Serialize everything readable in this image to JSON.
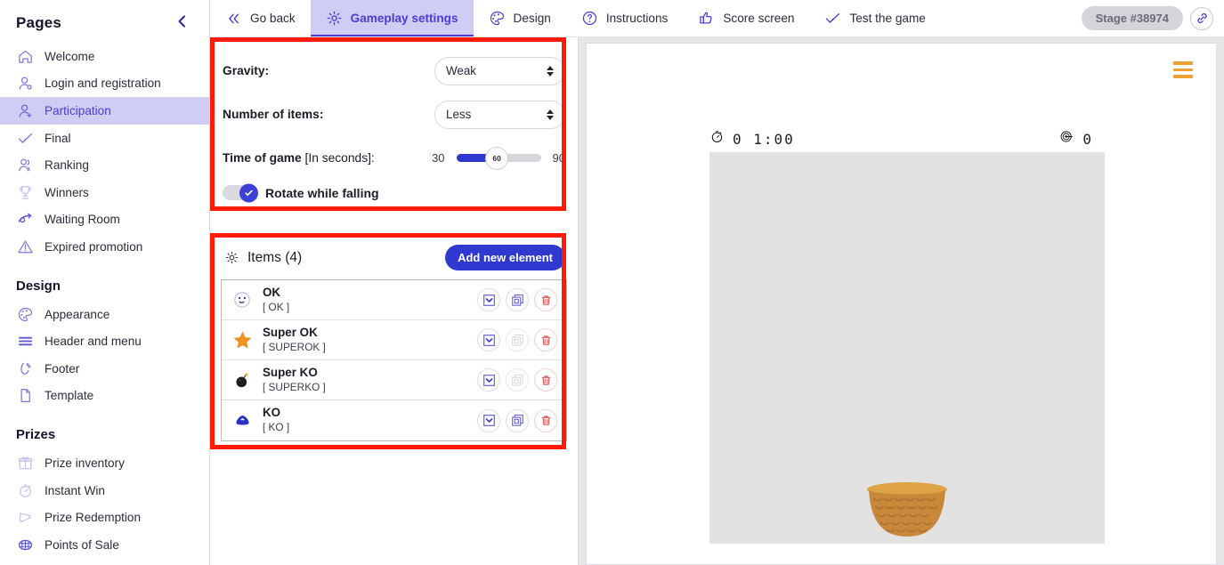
{
  "sidebar": {
    "title": "Pages",
    "collapse_icon": "chevron-left-icon",
    "pages": [
      {
        "label": "Welcome",
        "icon": "home-icon",
        "active": false,
        "dim": false
      },
      {
        "label": "Login and registration",
        "icon": "user-key-icon",
        "active": false,
        "dim": false
      },
      {
        "label": "Participation",
        "icon": "user-plus-icon",
        "active": true,
        "dim": false
      },
      {
        "label": "Final",
        "icon": "check-icon",
        "active": false,
        "dim": false
      },
      {
        "label": "Ranking",
        "icon": "users-icon",
        "active": false,
        "dim": false
      },
      {
        "label": "Winners",
        "icon": "trophy-icon",
        "active": false,
        "dim": true
      },
      {
        "label": "Waiting Room",
        "icon": "clock-arrow-icon",
        "active": false,
        "dim": false
      },
      {
        "label": "Expired promotion",
        "icon": "warning-triangle-icon",
        "active": false,
        "dim": false
      }
    ],
    "groups": [
      {
        "title": "Design",
        "items": [
          {
            "label": "Appearance",
            "icon": "palette-icon",
            "dim": false
          },
          {
            "label": "Header and menu",
            "icon": "menu-lines-icon",
            "dim": false
          },
          {
            "label": "Footer",
            "icon": "footer-shoe-icon",
            "dim": false
          },
          {
            "label": "Template",
            "icon": "document-icon",
            "dim": false
          }
        ]
      },
      {
        "title": "Prizes",
        "items": [
          {
            "label": "Prize inventory",
            "icon": "gift-icon",
            "dim": true
          },
          {
            "label": "Instant Win",
            "icon": "stopwatch-icon",
            "dim": true
          },
          {
            "label": "Prize Redemption",
            "icon": "ticket-icon",
            "dim": true
          },
          {
            "label": "Points of Sale",
            "icon": "globe-grid-icon",
            "dim": false
          }
        ]
      }
    ]
  },
  "topbar": {
    "tabs": [
      {
        "label": "Go back",
        "icon": "double-chevron-left-icon",
        "active": false
      },
      {
        "label": "Gameplay settings",
        "icon": "gear-icon",
        "active": true
      },
      {
        "label": "Design",
        "icon": "palette-icon",
        "active": false
      },
      {
        "label": "Instructions",
        "icon": "question-circle-icon",
        "active": false
      },
      {
        "label": "Score screen",
        "icon": "thumbs-up-icon",
        "active": false
      },
      {
        "label": "Test the game",
        "icon": "check-icon",
        "active": false
      }
    ],
    "stage_badge": "Stage #38974",
    "link_icon": "link-icon"
  },
  "gameplay": {
    "gravity": {
      "label": "Gravity:",
      "value": "Weak"
    },
    "number_of_items": {
      "label": "Number of items:",
      "value": "Less"
    },
    "time_of_game": {
      "label_bold": "Time of game",
      "label_light": "[In seconds]:",
      "min": "30",
      "max": "90",
      "value": "60",
      "fill_percent": 48
    },
    "rotate_while_falling": {
      "label": "Rotate while falling",
      "checked": true
    }
  },
  "items_panel": {
    "gear_icon": "gear-icon",
    "title": "Items (4)",
    "add_button": "Add new element",
    "rows": [
      {
        "name": "OK",
        "code": "[ OK ]",
        "icon": "smiley-face-icon",
        "duplicate_enabled": true
      },
      {
        "name": "Super OK",
        "code": "[ SUPEROK ]",
        "icon": "star-icon",
        "duplicate_enabled": false
      },
      {
        "name": "Super KO",
        "code": "[ SUPERKO ]",
        "icon": "bomb-icon",
        "duplicate_enabled": false
      },
      {
        "name": "KO",
        "code": "[ KO ]",
        "icon": "blue-gem-icon",
        "duplicate_enabled": true
      }
    ],
    "action_icons": [
      "chevron-down-box-icon",
      "duplicate-icon",
      "trash-icon"
    ]
  },
  "preview": {
    "burger_icon": "hamburger-menu-icon",
    "timer_icon": "stopwatch-icon",
    "timer_value": "0 1:00",
    "score_icon": "target-icon",
    "score_value": "0",
    "basket_icon": "basket-icon"
  },
  "colors": {
    "accent": "#4b3ddb",
    "accent_button": "#2f39cf",
    "active_nav_bg": "#cfcdf3",
    "annotation": "#fb1b08",
    "burger": "#eda033",
    "slider_fill": "#2f39cf",
    "play_area": "#e2e2e2",
    "preview_surround": "#e6e6e9",
    "stage_pill": "#d4d4d9",
    "trash": "#e05a5a"
  }
}
